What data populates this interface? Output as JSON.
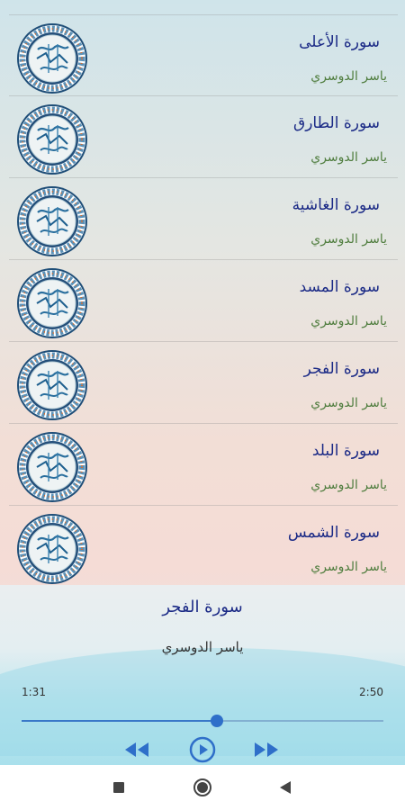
{
  "surah_list": [
    {
      "title": "سورة الأعلى",
      "reciter": "ياسر الدوسري"
    },
    {
      "title": "سورة الطارق",
      "reciter": "ياسر الدوسري"
    },
    {
      "title": "سورة الغاشية",
      "reciter": "ياسر الدوسري"
    },
    {
      "title": "سورة المسد",
      "reciter": "ياسر الدوسري"
    },
    {
      "title": "سورة الفجر",
      "reciter": "ياسر الدوسري"
    },
    {
      "title": "سورة البلد",
      "reciter": "ياسر الدوسري"
    },
    {
      "title": "سورة الشمس",
      "reciter": "ياسر الدوسري"
    }
  ],
  "player": {
    "title": "سورة الفجر",
    "reciter": "ياسر الدوسري",
    "current_time": "1:31",
    "duration": "2:50",
    "progress": 0.54,
    "state": "paused"
  },
  "icons": {
    "rewind": "rewind-icon",
    "play": "play-icon",
    "fast_forward": "fast-forward-icon",
    "recent_apps": "recent-apps-icon",
    "home": "home-icon",
    "back": "back-icon",
    "emblem": "quran-emblem-icon"
  },
  "colors": {
    "title": "#1b2a86",
    "reciter": "#4f7d3e",
    "accent": "#2f6fc9"
  }
}
